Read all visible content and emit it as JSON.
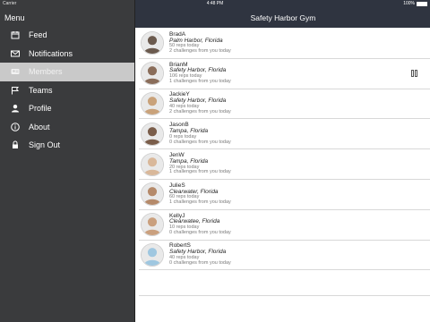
{
  "status_bar": {
    "carrier": "Carrier",
    "time": "4:48 PM",
    "battery": "100%"
  },
  "sidebar": {
    "title": "Menu",
    "items": [
      {
        "label": "Feed",
        "icon": "calendar-icon",
        "active": false
      },
      {
        "label": "Notifications",
        "icon": "envelope-icon",
        "active": false
      },
      {
        "label": "Members",
        "icon": "members-icon",
        "active": true
      },
      {
        "label": "Teams",
        "icon": "flag-icon",
        "active": false
      },
      {
        "label": "Profile",
        "icon": "person-icon",
        "active": false
      },
      {
        "label": "About",
        "icon": "info-icon",
        "active": false
      },
      {
        "label": "Sign Out",
        "icon": "lock-icon",
        "active": false
      }
    ]
  },
  "header": {
    "title": "Safety Harbor Gym"
  },
  "members": [
    {
      "name": "BradA",
      "location": "Palm Harbor, Florida",
      "reps": "50 reps today",
      "challenges": "2 challenges from you today",
      "avatar_color": "#6b5a4e"
    },
    {
      "name": "BrianM",
      "location": "Safety Harbor, Florida",
      "reps": "106 reps today",
      "challenges": "1 challenges from you today",
      "avatar_color": "#8a6d5a"
    },
    {
      "name": "JackieY",
      "location": "Safety Harbor, Florida",
      "reps": "40 reps today",
      "challenges": "2 challenges from you today",
      "avatar_color": "#c9a27a"
    },
    {
      "name": "JasonB",
      "location": "Tampa, Florida",
      "reps": "0 reps today",
      "challenges": "0 challenges from you today",
      "avatar_color": "#7a5d4a"
    },
    {
      "name": "JenW",
      "location": "Tampa, Florida",
      "reps": "20 reps today",
      "challenges": "1 challenges from you today",
      "avatar_color": "#d9b89a"
    },
    {
      "name": "JulieS",
      "location": "Clearwater, Florida",
      "reps": "60 reps today",
      "challenges": "1 challenges from you today",
      "avatar_color": "#b58a6a"
    },
    {
      "name": "KellyJ",
      "location": "Clearwatee, Florida",
      "reps": "10 reps today",
      "challenges": "0 challenges from you today",
      "avatar_color": "#caa07e"
    },
    {
      "name": "RobertS",
      "location": "Safety Harbor, Florida",
      "reps": "40 reps today",
      "challenges": "0 challenges from you today",
      "avatar_color": "#9fc7e0"
    }
  ],
  "colors": {
    "sidebar_bg": "#3a3b3d",
    "active_item_bg": "#c9c9c9",
    "navbar_bg": "#2f3440"
  }
}
